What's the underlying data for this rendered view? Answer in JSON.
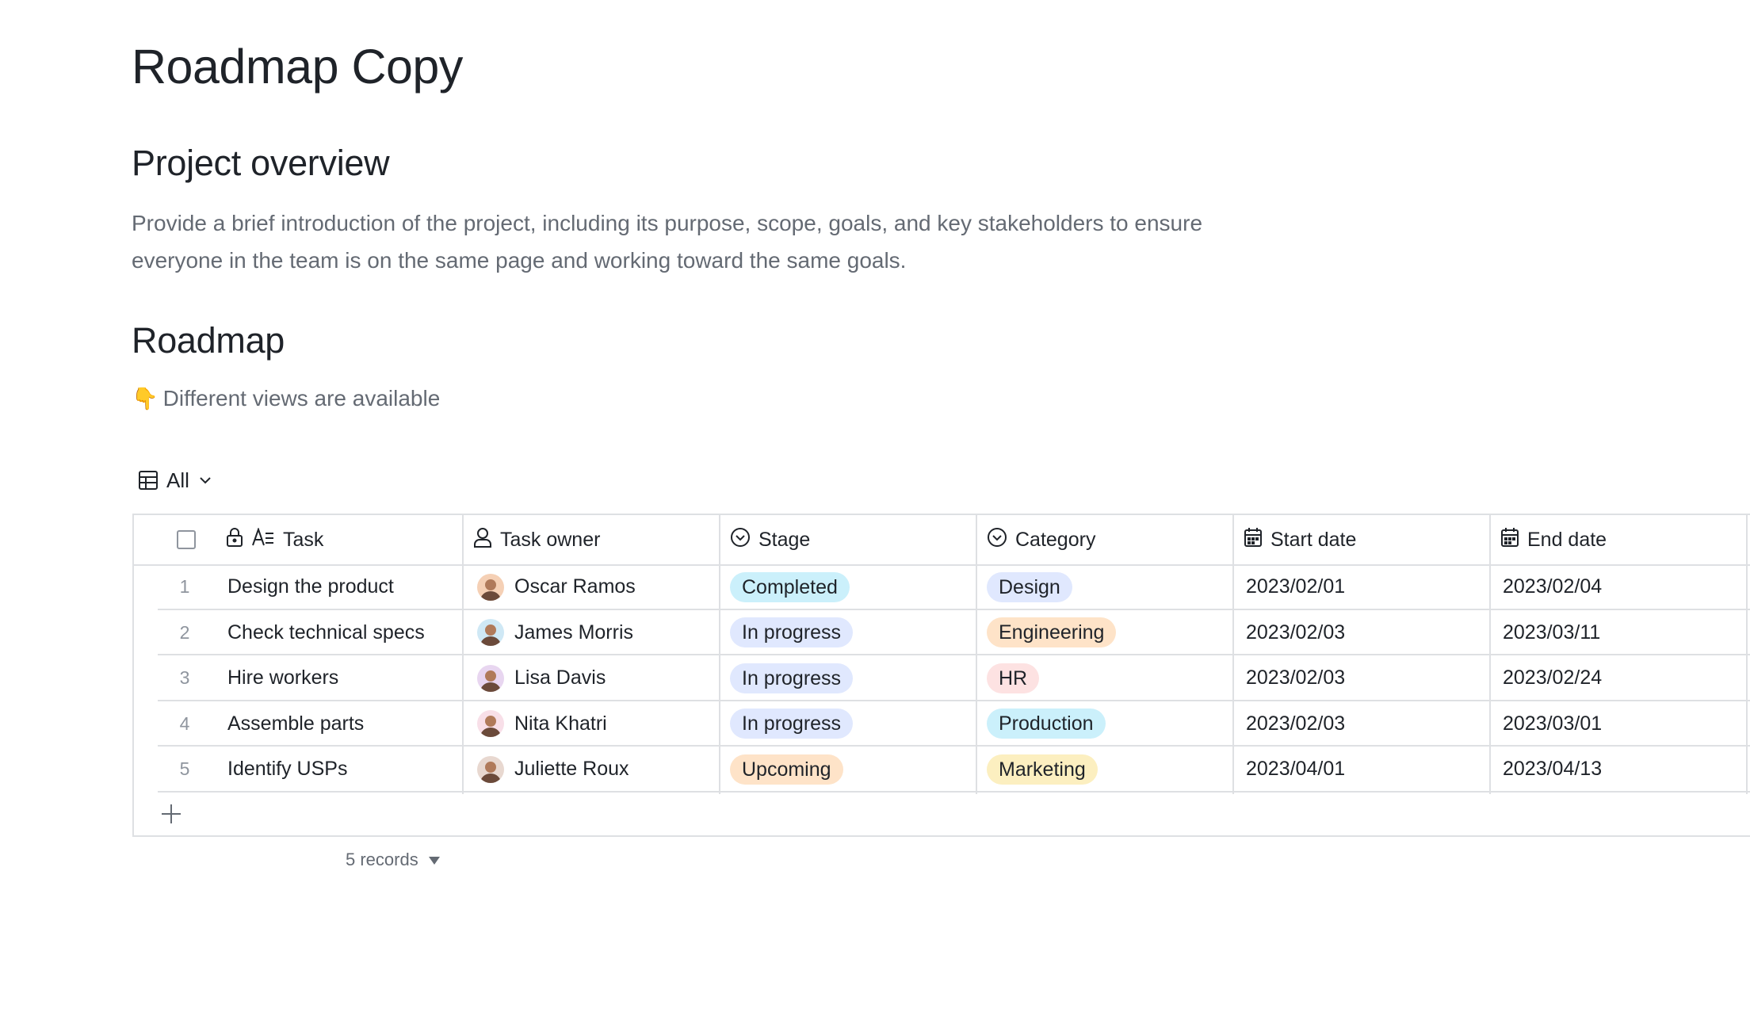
{
  "page": {
    "title": "Roadmap Copy",
    "overview_heading": "Project overview",
    "overview_text": "Provide a brief introduction of the project, including its purpose, scope, goals, and key stakeholders to ensure everyone in the team is on the same page and working toward the same goals.",
    "roadmap_heading": "Roadmap",
    "hint_emoji": "👇",
    "hint_text": "Different views are available"
  },
  "view": {
    "label": "All",
    "icon": "grid-table-icon",
    "chevron": "chevron-down-icon"
  },
  "table": {
    "columns": [
      {
        "label": "Task",
        "icons": [
          "lock-icon",
          "text-field-icon"
        ]
      },
      {
        "label": "Task owner",
        "icon": "person-icon"
      },
      {
        "label": "Stage",
        "icon": "single-select-icon"
      },
      {
        "label": "Category",
        "icon": "single-select-icon"
      },
      {
        "label": "Start date",
        "icon": "calendar-icon"
      },
      {
        "label": "End date",
        "icon": "calendar-icon"
      }
    ],
    "rows": [
      {
        "num": "1",
        "task": "Design the product",
        "owner": "Oscar Ramos",
        "stage": "Completed",
        "category": "Design",
        "start": "2023/02/01",
        "end": "2023/02/04"
      },
      {
        "num": "2",
        "task": "Check technical specs",
        "owner": "James Morris",
        "stage": "In progress",
        "category": "Engineering",
        "start": "2023/02/03",
        "end": "2023/03/11"
      },
      {
        "num": "3",
        "task": "Hire workers",
        "owner": "Lisa Davis",
        "stage": "In progress",
        "category": "HR",
        "start": "2023/02/03",
        "end": "2023/02/24"
      },
      {
        "num": "4",
        "task": "Assemble parts",
        "owner": "Nita Khatri",
        "stage": "In progress",
        "category": "Production",
        "start": "2023/02/03",
        "end": "2023/03/01"
      },
      {
        "num": "5",
        "task": "Identify USPs",
        "owner": "Juliette Roux",
        "stage": "Upcoming",
        "category": "Marketing",
        "start": "2023/04/01",
        "end": "2023/04/13"
      }
    ],
    "tag_colors": {
      "Completed": "#cbf0fb",
      "In progress": "#e0e8fe",
      "Upcoming": "#fee3c8",
      "Design": "#e0e8fe",
      "Engineering": "#fee3c8",
      "HR": "#fde2e2",
      "Production": "#cbf0fb",
      "Marketing": "#fcefc0"
    },
    "avatar_colors": [
      "#f5d0b5",
      "#cfe8f5",
      "#e8d6f0",
      "#f8dfe8",
      "#e8d8d0"
    ],
    "footer": {
      "records": "5 records",
      "add_icon": "plus-icon",
      "dropdown_icon": "caret-down-icon"
    }
  }
}
